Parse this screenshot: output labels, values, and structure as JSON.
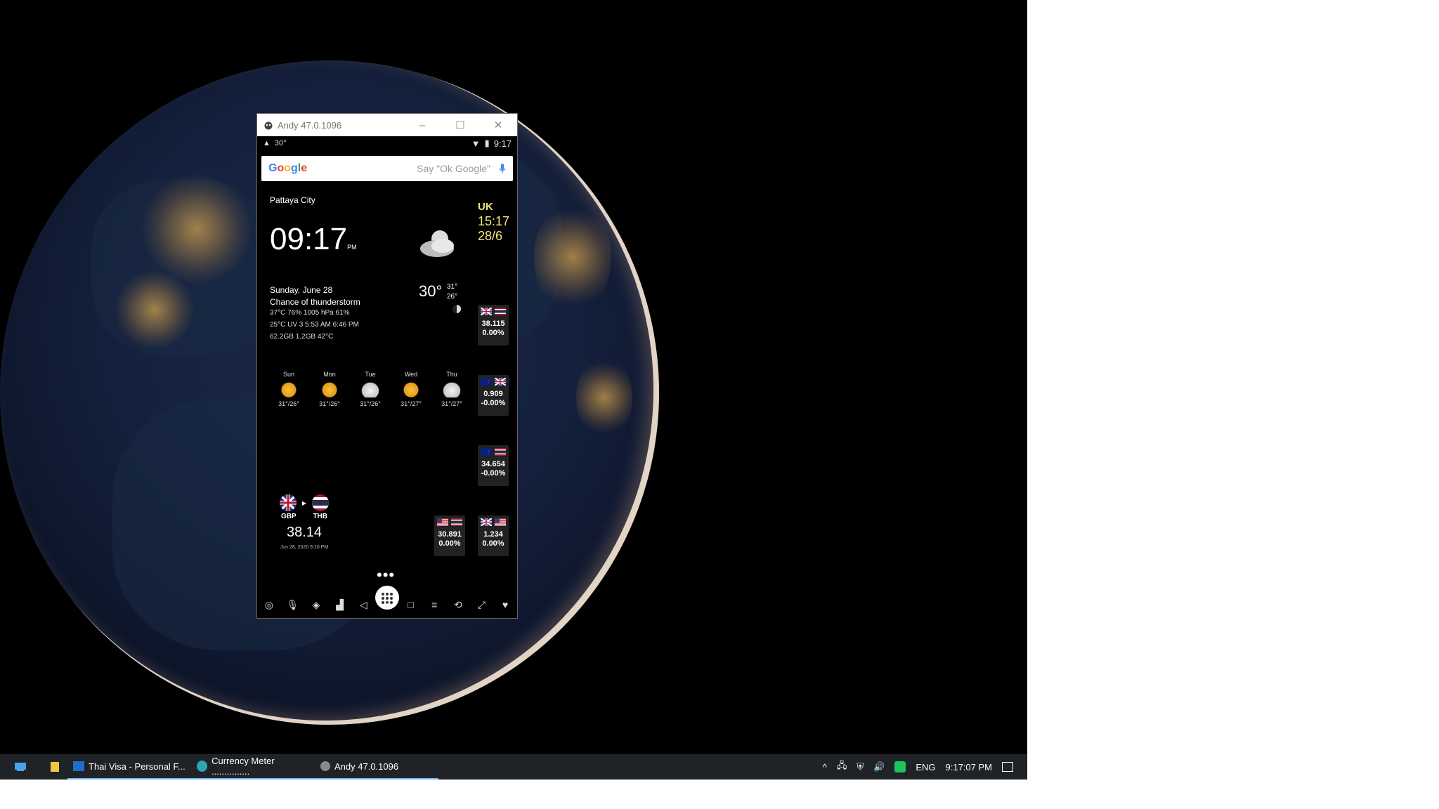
{
  "window": {
    "title": "Andy 47.0.1096",
    "controls": {
      "minimize": "–",
      "maximize": "☐",
      "close": "✕"
    }
  },
  "status_bar": {
    "temp": "30°",
    "time": "9:17"
  },
  "google_search": {
    "logo": "Google",
    "hint": "Say \"Ok Google\""
  },
  "weather": {
    "city": "Pattaya City",
    "clock": "09:17",
    "ampm": "PM",
    "date": "Sunday, June 28",
    "condition": "Chance of thunderstorm",
    "detail_line1": "37°C   76%   1005 hPa   61%",
    "detail_line2": "25°C UV 3   5:53 AM   6:46 PM",
    "detail_line3": "62.2GB   1.2GB   42°C",
    "temp": "30°",
    "temp_high": "31°",
    "temp_low": "26°",
    "forecast": [
      {
        "day": "Sun",
        "range": "31°/26°",
        "icon": "sunny-icon"
      },
      {
        "day": "Mon",
        "range": "31°/26°",
        "icon": "sunny-icon"
      },
      {
        "day": "Tue",
        "range": "31°/26°",
        "icon": "cloudy-icon"
      },
      {
        "day": "Wed",
        "range": "31°/27°",
        "icon": "sunny-icon"
      },
      {
        "day": "Thu",
        "range": "31°/27°",
        "icon": "cloudy-icon"
      }
    ]
  },
  "uk_clock": {
    "label": "UK",
    "time": "15:17",
    "date": "28/6"
  },
  "currency_tiles": [
    {
      "pair": "GBP-THB",
      "value": "38.115",
      "change": "0.00%"
    },
    {
      "pair": "NZD-GBP",
      "value": "0.909",
      "change": "-0.00%"
    },
    {
      "pair": "NZD-THB",
      "value": "34.654",
      "change": "-0.00%"
    },
    {
      "pair": "USD-THB",
      "value": "30.891",
      "change": "0.00%"
    },
    {
      "pair": "GBP-USD",
      "value": "1.234",
      "change": "0.00%"
    }
  ],
  "converter": {
    "from": "GBP",
    "to": "THB",
    "rate": "38.14",
    "timestamp": "Jun 28, 2020 9:10 PM"
  },
  "taskbar": {
    "items": [
      {
        "label": "Thai Visa - Personal F..."
      },
      {
        "label": "Currency Meter ..............."
      },
      {
        "label": "Andy 47.0.1096"
      }
    ],
    "lang": "ENG",
    "time": "9:17:07 PM"
  },
  "colors": {
    "uk_text": "#f3e57a",
    "taskbar": "#1f2328",
    "active_underline": "#76b9ed"
  }
}
